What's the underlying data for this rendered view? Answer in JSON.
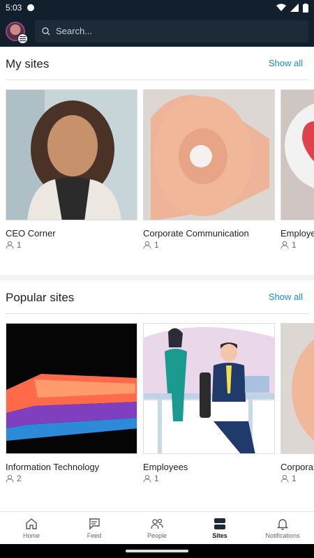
{
  "status": {
    "time": "5:03"
  },
  "header": {
    "search_placeholder": "Search..."
  },
  "my_sites": {
    "title": "My sites",
    "show_all": "Show all",
    "cards": [
      {
        "title": "CEO Corner",
        "members": "1"
      },
      {
        "title": "Corporate Communication",
        "members": "1"
      },
      {
        "title": "Employees",
        "members": "1"
      }
    ]
  },
  "popular_sites": {
    "title": "Popular sites",
    "show_all": "Show all",
    "cards": [
      {
        "title": "Information Technology",
        "members": "2"
      },
      {
        "title": "Employees",
        "members": "1"
      },
      {
        "title": "Corporate Communication",
        "members": "1"
      }
    ]
  },
  "nav": [
    {
      "label": "Home",
      "icon": "home-icon"
    },
    {
      "label": "Feed",
      "icon": "feed-icon"
    },
    {
      "label": "People",
      "icon": "people-icon"
    },
    {
      "label": "Sites",
      "icon": "sites-icon"
    },
    {
      "label": "Notifications",
      "icon": "bell-icon"
    }
  ],
  "nav_active": "Sites",
  "colors": {
    "header_bg": "#12202e",
    "accent": "#1d8ac9"
  }
}
